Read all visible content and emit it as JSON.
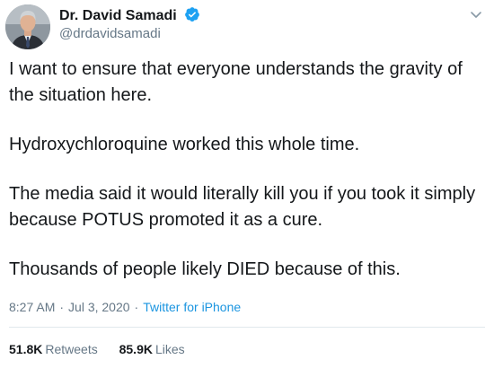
{
  "author": {
    "display_name": "Dr. David Samadi",
    "handle": "@drdavidsamadi",
    "verified": true
  },
  "tweet": {
    "paragraphs": [
      "I want to ensure that everyone understands the gravity of the situation here.",
      "Hydroxychloroquine worked this whole time.",
      "The media said it would literally kill you if you took it simply because POTUS promoted it as a cure.",
      "Thousands of people likely DIED because of this."
    ]
  },
  "meta": {
    "time": "8:27 AM",
    "separator": "·",
    "date": "Jul 3, 2020",
    "source": "Twitter for iPhone"
  },
  "stats": {
    "retweets_count": "51.8K",
    "retweets_label": "Retweets",
    "likes_count": "85.9K",
    "likes_label": "Likes"
  },
  "icons": {
    "verified": "verified-badge-icon",
    "caret": "chevron-down-icon"
  },
  "colors": {
    "text": "#14171a",
    "secondary": "#657786",
    "link": "#1b95e0",
    "verified": "#1da1f2",
    "divider": "#e1e8ed"
  }
}
